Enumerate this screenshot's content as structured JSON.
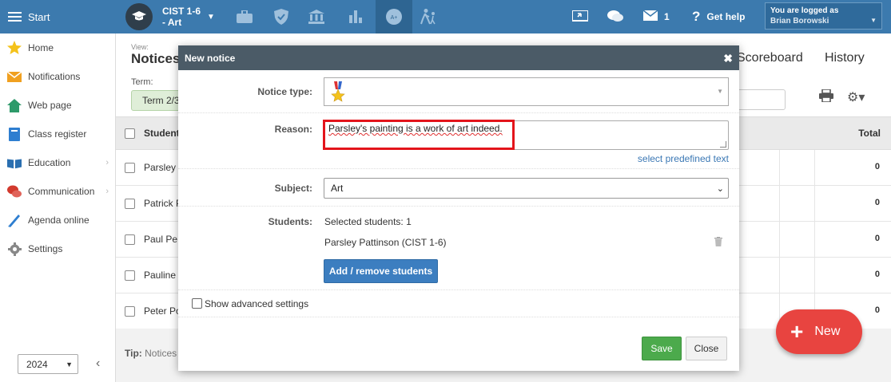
{
  "topbar": {
    "start_label": "Start",
    "class_name_line1": "CIST 1-6",
    "class_name_line2": "- Art",
    "message_count": "1",
    "get_help_label": "Get help",
    "logged_in_label": "You are logged as",
    "user_name": "Brian Borowski"
  },
  "sidebar": {
    "items": [
      {
        "label": "Home",
        "icon": "star-icon"
      },
      {
        "label": "Notifications",
        "icon": "envelope-icon"
      },
      {
        "label": "Web page",
        "icon": "house-icon"
      },
      {
        "label": "Class register",
        "icon": "notebook-icon"
      },
      {
        "label": "Education",
        "icon": "book-icon"
      },
      {
        "label": "Communication",
        "icon": "chat-icon"
      },
      {
        "label": "Agenda online",
        "icon": "pen-icon"
      },
      {
        "label": "Settings",
        "icon": "gear-icon"
      }
    ],
    "year": "2024"
  },
  "main": {
    "view_label": "View:",
    "view_title": "Notices",
    "term_label": "Term:",
    "term_value": "Term 2/3",
    "tab_scoreboard": "Scoreboard",
    "tab_history": "History",
    "col_students": "Students",
    "col_total": "Total",
    "rows": [
      {
        "name": "Parsley",
        "total": "0"
      },
      {
        "name": "Patrick P",
        "total": "0"
      },
      {
        "name": "Paul Pe",
        "total": "0"
      },
      {
        "name": "Pauline",
        "total": "0"
      },
      {
        "name": "Peter Po",
        "total": "0"
      }
    ],
    "tip_label": "Tip:",
    "tip_text": "Notices"
  },
  "fab": {
    "label": "New"
  },
  "modal": {
    "title": "New notice",
    "notice_type_label": "Notice type:",
    "reason_label": "Reason:",
    "reason_value": "Parsley's painting is a work of art indeed.",
    "predefined_link": "select predefined text",
    "subject_label": "Subject:",
    "subject_value": "Art",
    "students_label": "Students:",
    "selected_students": "Selected students: 1",
    "student_entry": "Parsley Pattinson (CIST 1-6)",
    "add_remove_label": "Add / remove students",
    "advanced_label": "Show advanced settings",
    "save_label": "Save",
    "close_label": "Close"
  },
  "colors": {
    "topbar": "#3c7aae",
    "modal_header": "#4b5b67",
    "save_green": "#4caa4c",
    "primary_blue": "#3c7ec0",
    "fab_red": "#e84440",
    "highlight_red": "#e3141b"
  }
}
